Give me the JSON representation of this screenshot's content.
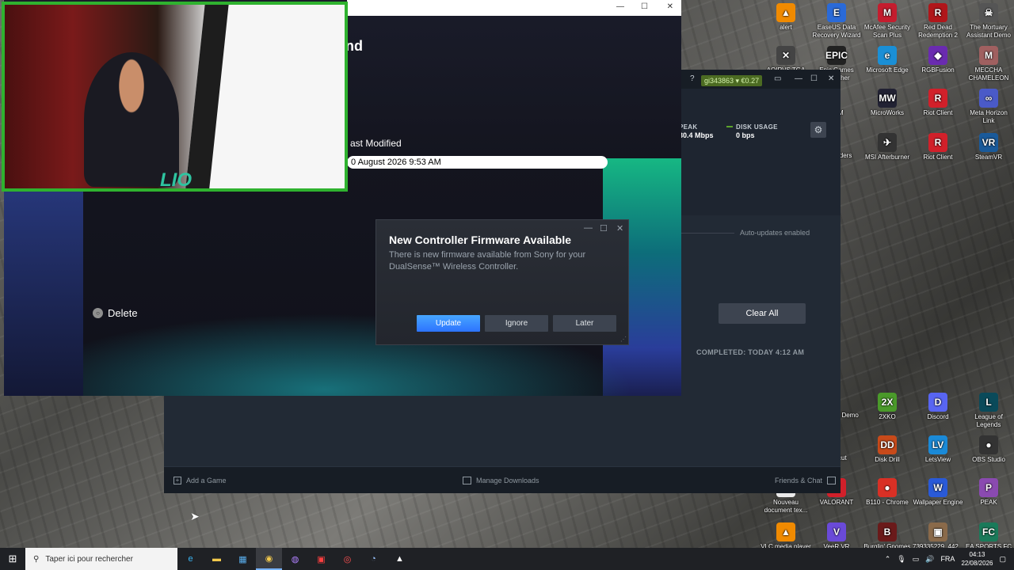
{
  "desktop": {
    "icons": [
      {
        "label": "alert",
        "color": "#f08a00",
        "glyph": "▲"
      },
      {
        "label": "EaseUS Data Recovery Wizard",
        "color": "#2a6ad8",
        "glyph": "E"
      },
      {
        "label": "McAfee Security Scan Plus",
        "color": "#c41d2e",
        "glyph": "M"
      },
      {
        "label": "Red Dead Redemption 2",
        "color": "#b0161a",
        "glyph": "R"
      },
      {
        "label": "The Mortuary Assistant Demo",
        "color": "#555",
        "glyph": "☠"
      },
      {
        "label": "AOIRVS TGA",
        "color": "#444",
        "glyph": "✕"
      },
      {
        "label": "Epic Games Launcher",
        "color": "#222",
        "glyph": "EPIC"
      },
      {
        "label": "Microsoft Edge",
        "color": "#1a8fd6",
        "glyph": "e"
      },
      {
        "label": "RGBFusion",
        "color": "#6a2bb0",
        "glyph": "◆"
      },
      {
        "label": "MECCHA CHAMELEON",
        "color": "#a06060",
        "glyph": "M"
      },
      {
        "label": "MicroWorks",
        "color": "#223",
        "glyph": "MW"
      },
      {
        "label": "Riot Client",
        "color": "#d1202a",
        "glyph": "R"
      },
      {
        "label": "Meta Horizon Link",
        "color": "#4a5ac8",
        "glyph": "∞"
      },
      {
        "label": "MSI Afterburner",
        "color": "#333",
        "glyph": "✈"
      },
      {
        "label": "Riot Client",
        "color": "#d1202a",
        "glyph": "R"
      },
      {
        "label": "SteamVR",
        "color": "#1a5a9a",
        "glyph": "VR"
      },
      {
        "label": "2XKO",
        "color": "#4a9a2a",
        "glyph": "2X"
      },
      {
        "label": "Discord",
        "color": "#5865f2",
        "glyph": "D"
      },
      {
        "label": "League of Legends",
        "color": "#0a4a5a",
        "glyph": "L"
      },
      {
        "label": "Disk Drill",
        "color": "#c84a1a",
        "glyph": "DD"
      },
      {
        "label": "LetsView",
        "color": "#1a8ad8",
        "glyph": "LV"
      },
      {
        "label": "OBS Studio",
        "color": "#333",
        "glyph": "●"
      },
      {
        "label": "B110 - Chrome",
        "color": "#d93025",
        "glyph": "●"
      },
      {
        "label": "Wallpaper Engine",
        "color": "#2a5ad8",
        "glyph": "W"
      },
      {
        "label": "PEAK",
        "color": "#8a4ab0",
        "glyph": "P"
      },
      {
        "label": "Nouveau document tex...",
        "color": "#eaeaea",
        "glyph": "≡"
      },
      {
        "label": "VALORANT",
        "color": "#d1202a",
        "glyph": "V"
      },
      {
        "label": "VLC media player",
        "color": "#f08a00",
        "glyph": "▲"
      },
      {
        "label": "VeeR VR",
        "color": "#6a4ad8",
        "glyph": "V"
      },
      {
        "label": "Burglin' Gnomes",
        "color": "#6a1a1a",
        "glyph": "B"
      },
      {
        "label": "739335229_442...",
        "color": "#8a6a4a",
        "glyph": "▣"
      },
      {
        "label": "EA SPORTS FC 25",
        "color": "#1a7a5a",
        "glyph": "FC"
      }
    ],
    "partial_labels": {
      "m": "M",
      "iders": "iders",
      "demo": "t Demo",
      "cut": "cut"
    }
  },
  "steam": {
    "help": "?",
    "account": "gi343863 ▾ €0.27",
    "peak_label": "PEAK",
    "peak_value": "30.4 Mbps",
    "disk_label": "DISK USAGE",
    "disk_value": "0 bps",
    "auto_updates": "Auto-updates enabled",
    "clear_all": "Clear All",
    "completed": "COMPLETED: TODAY 4:12 AM",
    "add_game": "Add a Game",
    "manage_downloads": "Manage Downloads",
    "friends_chat": "Friends & Chat"
  },
  "media": {
    "title_fragment": "nd",
    "last_modified_label": "ast Modified",
    "last_modified_value": "0 August 2026 9:53 AM",
    "delete_label": "Delete"
  },
  "webcam": {
    "overlay_text": "LIO"
  },
  "dialog": {
    "title": "New Controller Firmware Available",
    "body": "There is new firmware available from Sony for your DualSense™ Wireless Controller.",
    "update": "Update",
    "ignore": "Ignore",
    "later": "Later"
  },
  "taskbar": {
    "search_placeholder": "Taper ici pour rechercher",
    "lang": "FRA",
    "time": "04:13",
    "date": "22/08/2026"
  }
}
